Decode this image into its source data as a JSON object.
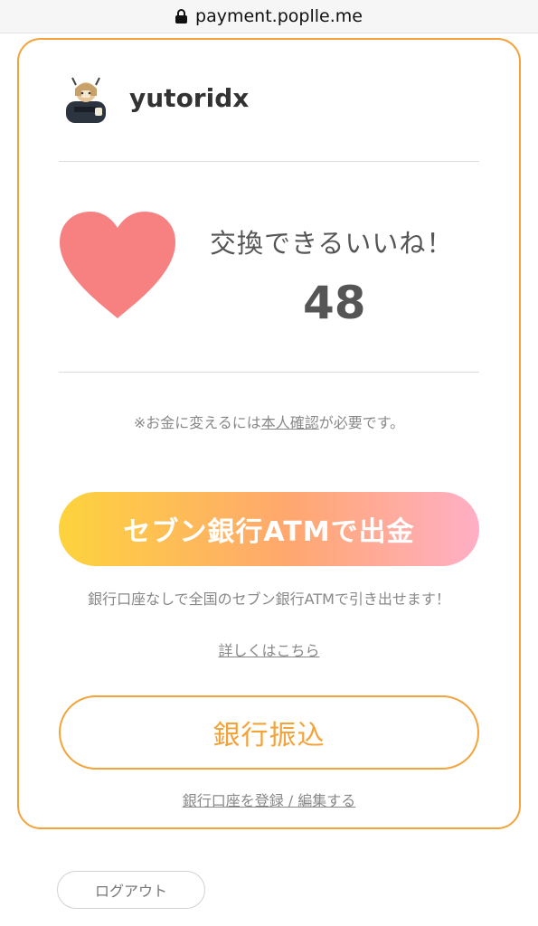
{
  "browser": {
    "url": "payment.poplle.me"
  },
  "profile": {
    "username": "yutoridx"
  },
  "likes": {
    "label": "交換できるいいね！",
    "count": "48"
  },
  "notice": {
    "prefix": "※お金に変えるには",
    "link": "本人確認",
    "suffix": "が必要です。"
  },
  "atm": {
    "button_label": "セブン銀行ATMで出金",
    "description": "銀行口座なしで全国のセブン銀行ATMで引き出せます！",
    "details_link": "詳しくはこちら"
  },
  "transfer": {
    "button_label": "銀行振込",
    "register_link": "銀行口座を登録 / 編集する"
  },
  "logout": {
    "button_label": "ログアウト"
  },
  "colors": {
    "accent": "#f3a33a",
    "heart": "#f78080",
    "gradient_start": "#fdd33d",
    "gradient_mid": "#ffa76f",
    "gradient_end": "#ffafc6"
  }
}
